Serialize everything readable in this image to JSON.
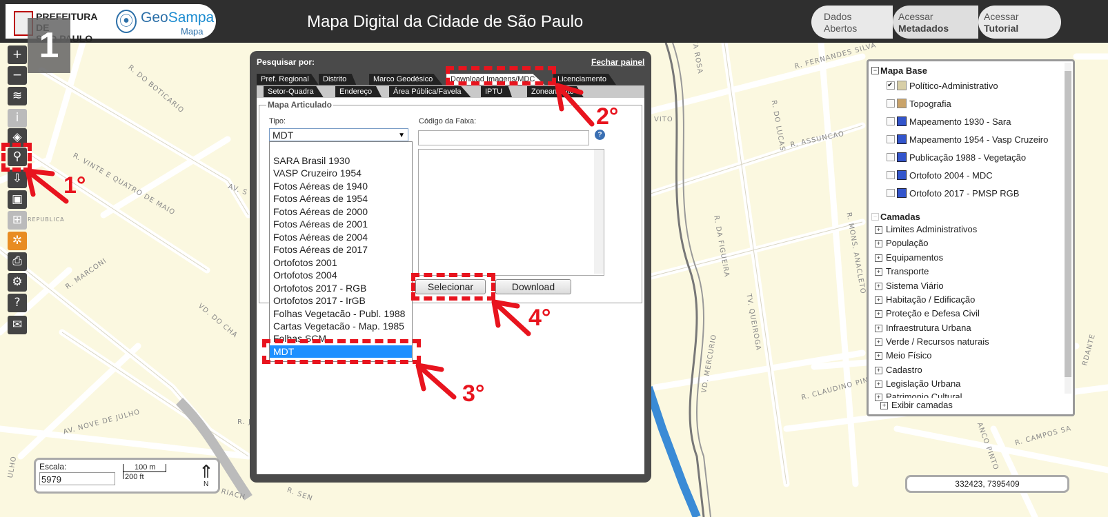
{
  "header": {
    "prefeitura_text": "PREFEITURA DE\nSÃO PAULO",
    "geo_text_prefix": "Geo",
    "geo_text_suffix": "Sampa",
    "geo_subtext": "Mapa",
    "title": "Mapa Digital da Cidade de São Paulo",
    "buttons": [
      {
        "line1": "Dados",
        "line2": "Abertos"
      },
      {
        "line1": "Acessar",
        "line2": "Metadados"
      },
      {
        "line1": "Acessar",
        "line2": "Tutorial"
      }
    ]
  },
  "step_badge": "1",
  "toolbar": {
    "icons": [
      "zoom-in-icon",
      "zoom-out-icon",
      "layers-icon",
      "info-icon",
      "compass-icon",
      "search-icon",
      "download-icon",
      "save-icon",
      "ruler-icon",
      "bicycle-icon",
      "print-icon",
      "settings-icon",
      "help-icon",
      "mail-icon"
    ],
    "glyphs": [
      "+",
      "−",
      "≋",
      "i",
      "◈",
      "⚲",
      "⇩",
      "▣",
      "⊞",
      "✲",
      "⎙",
      "⚙",
      "?",
      "✉"
    ]
  },
  "panel": {
    "search_by": "Pesquisar por:",
    "close": "Fechar painel",
    "tabs_row1": [
      "Pref. Regional",
      "Distrito",
      "Marco Geodésico",
      "Download Imagens/MDC",
      "Licenciamento"
    ],
    "tabs_row2": [
      "Setor-Quadra",
      "Endereço",
      "Área Pública/Favela",
      "IPTU",
      "Zoneamento"
    ],
    "fieldset_legend": "Mapa Articulado",
    "tipo_label": "Tipo:",
    "tipo_value": "MDT",
    "codigo_label": "Código da Faixa:",
    "help_glyph": "?",
    "options": [
      "SARA Brasil 1930",
      "VASP Cruzeiro 1954",
      "Fotos Aéreas de 1940",
      "Fotos Aéreas de 1954",
      "Fotos Aéreas de 2000",
      "Fotos Aéreas de 2001",
      "Fotos Aéreas de 2004",
      "Fotos Aéreas de 2017",
      "Ortofotos 2001",
      "Ortofotos 2004",
      "Ortofotos 2017 - RGB",
      "Ortofotos 2017 - IrGB",
      "Folhas Vegetacão - Publ. 1988",
      "Cartas Vegetacão - Map. 1985",
      "Folhas SCM",
      "MDT"
    ],
    "selected_option": "MDT",
    "select_button": "Selecionar",
    "download_button": "Download"
  },
  "layers": {
    "base_title": "Mapa Base",
    "base_items": [
      {
        "label": "Político-Administrativo",
        "checked": true,
        "swatch": "#d8cfa8"
      },
      {
        "label": "Topografia",
        "checked": false,
        "swatch": "#c9a36a"
      },
      {
        "label": "Mapeamento 1930 - Sara",
        "checked": false,
        "swatch": "#3355cc"
      },
      {
        "label": "Mapeamento 1954 - Vasp Cruzeiro",
        "checked": false,
        "swatch": "#3355cc"
      },
      {
        "label": "Publicação 1988 - Vegetação",
        "checked": false,
        "swatch": "#3355cc"
      },
      {
        "label": "Ortofoto 2004 - MDC",
        "checked": false,
        "swatch": "#3355cc"
      },
      {
        "label": "Ortofoto 2017 - PMSP RGB",
        "checked": false,
        "swatch": "#3355cc"
      }
    ],
    "camadas_title": "Camadas",
    "camadas": [
      "Limites Administrativos",
      "População",
      "Equipamentos",
      "Transporte",
      "Sistema Viário",
      "Habitação / Edificação",
      "Proteção e Defesa Civil",
      "Infraestrutura Urbana",
      "Verde / Recursos naturais",
      "Meio Físico",
      "Cadastro",
      "Legislação Urbana",
      "Patrimonio Cultural"
    ],
    "exibir": "Exibir camadas",
    "check_glyph": "✔",
    "plus_glyph": "+",
    "minus_glyph": "−"
  },
  "scale": {
    "label": "Escala:",
    "value": "5979",
    "bar_m": "100 m",
    "bar_ft": "200 ft",
    "north": "N"
  },
  "coords": "332423, 7395409",
  "annotations": {
    "step1": "1°",
    "step2": "2°",
    "step3": "3°",
    "step4": "4°"
  },
  "streets": [
    "R. DO BOTICARIO",
    "R. VINTE E QUATRO DE MAIO",
    "AV. S",
    "R. MARCONI",
    "VD. DO CHA",
    "AV. NOVE DE JULHO",
    "R. JOS",
    "R. SEN",
    "R. FERNANDES SILVA",
    "R. DO LUCAS",
    "R. ASSUNCAO",
    "R. MONS. ANACLETO",
    "R. DA FIGUEIRA",
    "TV. QUEIROGA",
    "VD. MERCURIO",
    "R. CLAUDINO PINTO",
    "R. CAMPOS SA",
    "VITO",
    "TA ROSA",
    "REPUBLICA",
    "RIACH",
    "ULHO",
    "RDANTE",
    "ANCO PINTO"
  ],
  "colors": {
    "accent_red": "#e8141e",
    "header_dark": "#2f2f2f",
    "panel_dark": "#4a4a4a",
    "selected_blue": "#1e90ff",
    "map_bg": "#fbf8e0",
    "river": "#3a8bd6"
  }
}
